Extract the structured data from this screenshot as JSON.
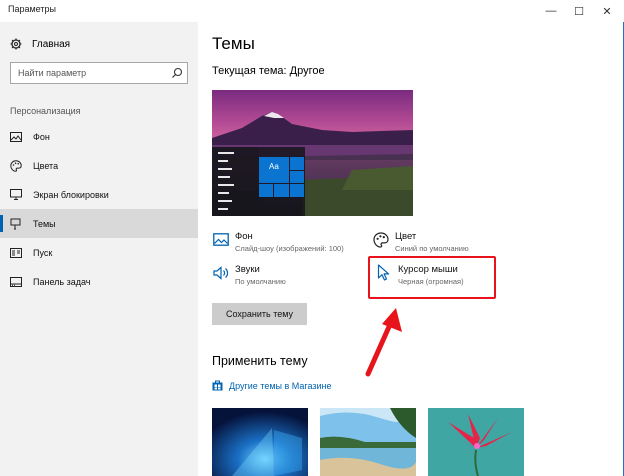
{
  "window": {
    "title": "Параметры",
    "minimize_glyph": "—",
    "maximize_glyph": "☐",
    "close_glyph": "✕"
  },
  "sidebar": {
    "home_label": "Главная",
    "search_placeholder": "Найти параметр",
    "section_label": "Персонализация",
    "items": [
      {
        "label": "Фон",
        "icon": "picture-icon"
      },
      {
        "label": "Цвета",
        "icon": "palette-icon"
      },
      {
        "label": "Экран блокировки",
        "icon": "monitor-icon"
      },
      {
        "label": "Темы",
        "icon": "brush-icon",
        "active": true
      },
      {
        "label": "Пуск",
        "icon": "start-icon"
      },
      {
        "label": "Панель задач",
        "icon": "taskbar-icon"
      }
    ]
  },
  "main": {
    "title": "Темы",
    "current_theme": "Текущая тема: Другое",
    "preview_tile_text": "Aa",
    "properties": {
      "background": {
        "title": "Фон",
        "subtitle": "Слайд-шоу (изображений: 100)"
      },
      "color": {
        "title": "Цвет",
        "subtitle": "Синий по умолчанию"
      },
      "sounds": {
        "title": "Звуки",
        "subtitle": "По умолчанию"
      },
      "cursor": {
        "title": "Курсор мыши",
        "subtitle": "Черная (огромная)"
      }
    },
    "save_button": "Сохранить тему",
    "apply_title": "Применить тему",
    "store_link": "Другие темы в Магазине"
  },
  "colors": {
    "accent": "#0063b1",
    "highlight": "#e8141b",
    "sidebar_bg": "#f2f2f2"
  }
}
